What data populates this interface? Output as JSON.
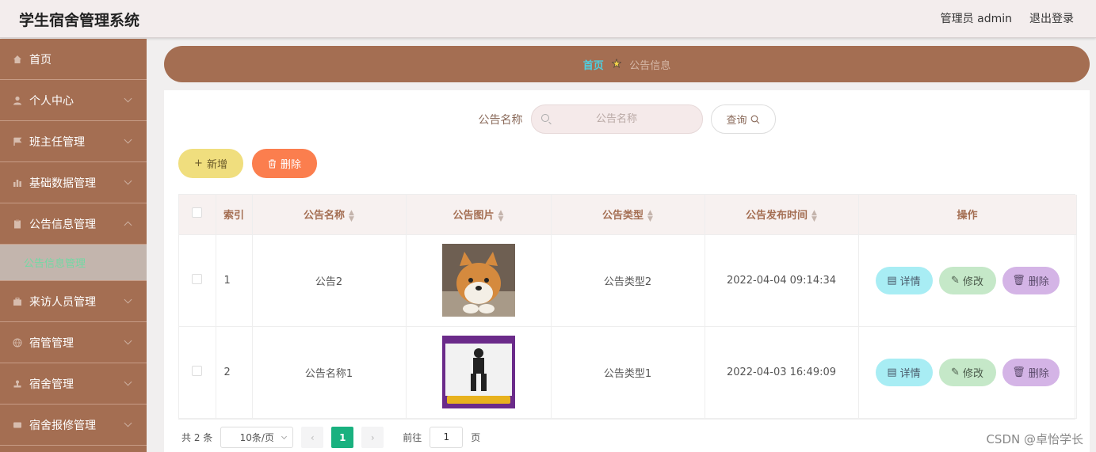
{
  "app": {
    "title": "学生宿舍管理系统"
  },
  "header": {
    "user": "管理员 admin",
    "logout": "退出登录"
  },
  "sidebar": {
    "items": [
      {
        "label": "首页",
        "icon": "home-icon"
      },
      {
        "label": "个人中心",
        "icon": "user-icon"
      },
      {
        "label": "班主任管理",
        "icon": "flag-icon"
      },
      {
        "label": "基础数据管理",
        "icon": "chart-icon"
      },
      {
        "label": "公告信息管理",
        "icon": "clipboard-icon"
      },
      {
        "label": "公告信息管理",
        "icon": "",
        "sub": true
      },
      {
        "label": "来访人员管理",
        "icon": "briefcase-icon"
      },
      {
        "label": "宿管管理",
        "icon": "globe-icon"
      },
      {
        "label": "宿舍管理",
        "icon": "stamp-icon"
      },
      {
        "label": "宿舍报修管理",
        "icon": "card-icon"
      }
    ]
  },
  "breadcrumb": {
    "home": "首页",
    "current": "公告信息"
  },
  "search": {
    "label": "公告名称",
    "placeholder": "公告名称",
    "button": "查询"
  },
  "actions": {
    "add": "新增",
    "delete": "删除"
  },
  "table": {
    "columns": [
      "索引",
      "公告名称",
      "公告图片",
      "公告类型",
      "公告发布时间",
      "操作"
    ],
    "rows": [
      {
        "index": "1",
        "name": "公告2",
        "image": "shiba-dog-photo",
        "type": "公告类型2",
        "time": "2022-04-04 09:14:34"
      },
      {
        "index": "2",
        "name": "公告名称1",
        "image": "fitness-poster",
        "type": "公告类型1",
        "time": "2022-04-03 16:49:09"
      }
    ],
    "row_actions": {
      "detail": "详情",
      "edit": "修改",
      "delete": "删除"
    }
  },
  "pagination": {
    "total": "共 2 条",
    "page_size": "10条/页",
    "current": "1",
    "goto_prefix": "前往",
    "goto_value": "1",
    "goto_suffix": "页"
  },
  "watermark": "CSDN @卓怡学长",
  "colors": {
    "brand": "#a46e52",
    "active": "#19b17f",
    "add": "#f0de7e",
    "delete": "#fb7e4e"
  }
}
